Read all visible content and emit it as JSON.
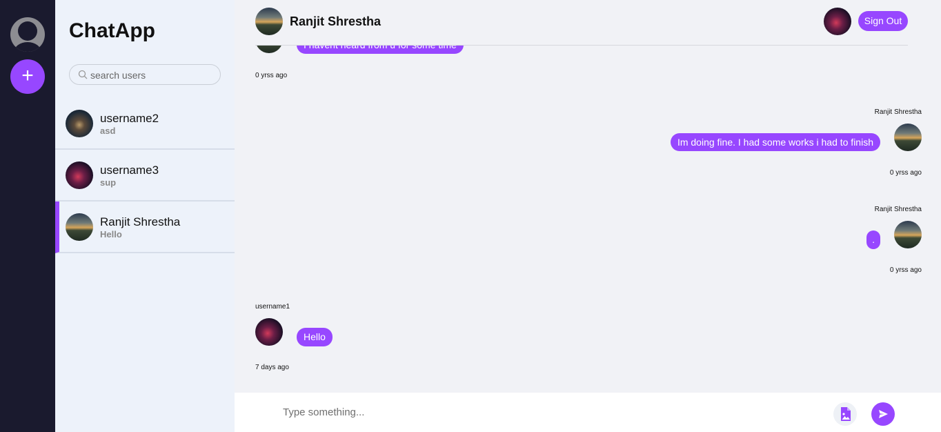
{
  "app": {
    "name": "ChatApp"
  },
  "rail": {
    "add_label": "+"
  },
  "search": {
    "placeholder": "search users"
  },
  "contacts": [
    {
      "name": "username2",
      "preview": "asd"
    },
    {
      "name": "username3",
      "preview": "sup"
    },
    {
      "name": "Ranjit Shrestha",
      "preview": "Hello"
    }
  ],
  "chat_header": {
    "title": "Ranjit Shrestha",
    "signout_label": "Sign Out"
  },
  "messages": [
    {
      "text": "I havent heard from u for some time",
      "time": "0 yrss ago"
    },
    {
      "sender": "Ranjit Shrestha",
      "text": "Im doing fine. I had some works i had to finish",
      "time": "0 yrss ago"
    },
    {
      "sender": "Ranjit Shrestha",
      "text": ".",
      "time": "0 yrss ago"
    },
    {
      "sender": "username1",
      "text": "Hello",
      "time": "7 days ago"
    }
  ],
  "composer": {
    "placeholder": "Type something..."
  },
  "icons": {
    "search": "search-icon",
    "attach": "image-file-icon",
    "send": "send-icon",
    "profile": "user-icon",
    "add": "plus-icon"
  },
  "colors": {
    "accent": "#9747ff",
    "rail": "#1a1a2e",
    "sidebar": "#edf2fa"
  }
}
